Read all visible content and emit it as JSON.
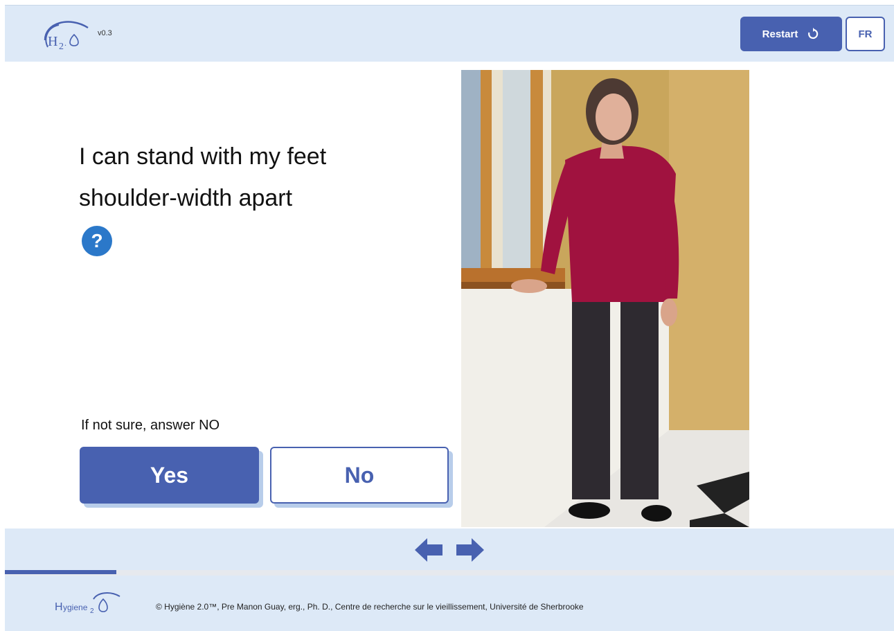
{
  "header": {
    "logo_text": "H2O",
    "version": "v0.3",
    "restart_label": "Restart",
    "language_label": "FR"
  },
  "question": {
    "line1": "I can stand with my feet",
    "line2": "shoulder-width apart",
    "help_symbol": "?"
  },
  "answer": {
    "hint": "If not sure, answer NO",
    "yes_label": "Yes",
    "no_label": "No"
  },
  "photo": {
    "icon": "woman-standing-photo"
  },
  "navigation": {
    "prev_icon": "arrow-left-icon",
    "next_icon": "arrow-right-icon",
    "progress_fraction": 0.125
  },
  "footer": {
    "logo_text": "Hygiene2O",
    "copyright": "© Hygiène 2.0™, Pre Manon Guay, erg., Ph. D., Centre de recherche sur le vieillissement, Université de Sherbrooke"
  },
  "colors": {
    "brand_blue": "#4861b0",
    "header_bg": "#dde9f7",
    "help_blue": "#2b78c9"
  }
}
